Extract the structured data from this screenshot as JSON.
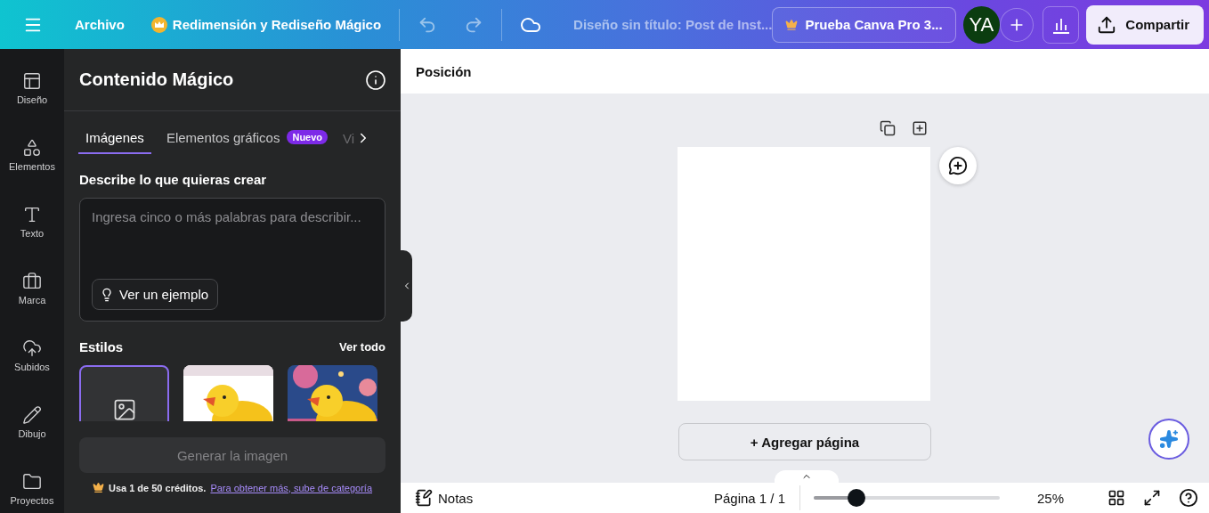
{
  "topbar": {
    "file_menu": "Archivo",
    "magic_resize": "Redimensión y Rediseño Mágico",
    "doc_title": "Diseño sin título: Post de Inst...",
    "trial": "Prueba Canva Pro 3...",
    "avatar": "YA",
    "share": "Compartir"
  },
  "rail": [
    {
      "label": "Diseño",
      "kind": "design",
      "selected": false
    },
    {
      "label": "Elementos",
      "kind": "elements",
      "selected": false
    },
    {
      "label": "Texto",
      "kind": "text",
      "selected": false
    },
    {
      "label": "Marca",
      "kind": "brand",
      "selected": false
    },
    {
      "label": "Subidos",
      "kind": "uploads",
      "selected": false
    },
    {
      "label": "Dibujo",
      "kind": "draw",
      "selected": false
    },
    {
      "label": "Proyectos",
      "kind": "projects",
      "selected": false
    }
  ],
  "panel": {
    "title": "Contenido Mágico",
    "tabs": [
      {
        "label": "Imágenes",
        "selected": true
      },
      {
        "label": "Elementos gráficos",
        "badge": "Nuevo",
        "selected": false
      },
      {
        "label": "Vi",
        "selected": false
      }
    ],
    "prompt_label": "Describe lo que quieras crear",
    "prompt": {
      "placeholder": "Ingresa cinco o más palabras para describir..."
    },
    "example_button": "Ver un ejemplo",
    "styles_title": "Estilos",
    "see_all": "Ver todo",
    "styles": [
      {
        "kind": "none",
        "selected": true
      },
      {
        "kind": "picture",
        "selected": false
      },
      {
        "kind": "picture",
        "selected": false
      }
    ],
    "generate": {
      "label": "Generar la imagen",
      "disabled": true
    },
    "credits": {
      "text": "Usa 1 de 50 créditos.",
      "link": "Para obtener más, sube de categoría"
    }
  },
  "context_bar": {
    "position": "Posición"
  },
  "canvas": {
    "add_page": "+ Agregar página"
  },
  "footer": {
    "notes": "Notas",
    "page": "Página 1 / 1",
    "zoom": {
      "level": 0.23
    },
    "zoom_reading": "25%"
  }
}
